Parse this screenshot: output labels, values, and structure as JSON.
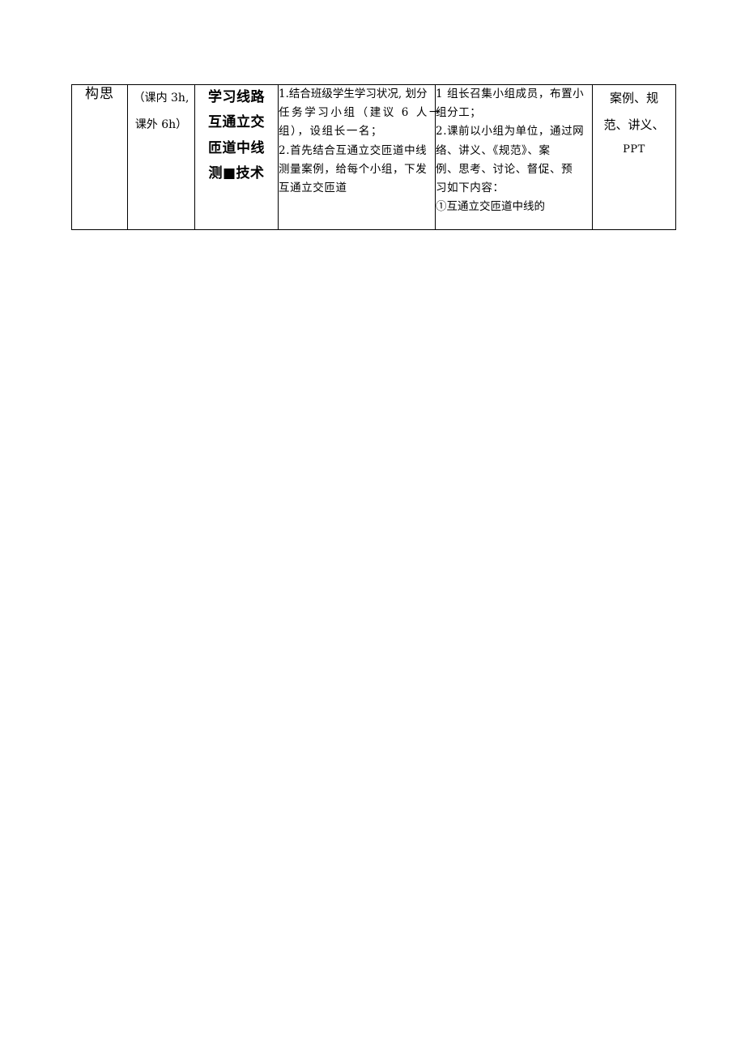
{
  "document": {
    "type": "course-plan-table",
    "page_background": "#ffffff",
    "text_color": "#000000",
    "border_color": "#000000"
  },
  "table": {
    "row": {
      "stage": "构思",
      "hours": {
        "line1": "（课内 3h,",
        "line2": "课外 6h）"
      },
      "topic": {
        "line1": "学习线路",
        "line2": "互通立交",
        "line3": "匝道中线",
        "line4": "测■技术"
      },
      "teacher_activity": {
        "line1": "1.结合班级学生学习状况, 划分",
        "line2": "任务学习小组（建议 6 人一",
        "line3": "组），设组长一名；",
        "line4": "2.首先结合互通立交匝道中线",
        "line5": "测量案例，给每个小组，下发",
        "line6": "互通立交匝道"
      },
      "student_activity": {
        "line1": "1 组长召集小组成员，布置小",
        "line2": "组分工；",
        "line3": "2.课前以小组为单位，通过网",
        "line4": "络、讲义、《规范》、案",
        "line5": "例、思考、讨论、督促、预",
        "line6": "习如下内容：",
        "line7": "①互通立交匝道中线的"
      },
      "resources": {
        "line1": "案例、规",
        "line2": "范、讲义、",
        "line3": "PPT"
      }
    }
  }
}
